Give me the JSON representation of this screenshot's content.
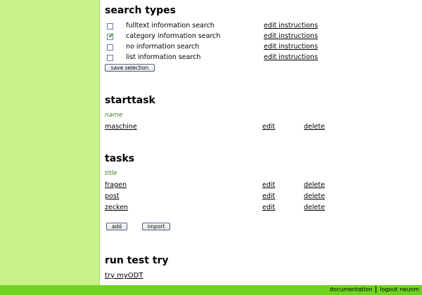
{
  "search_types": {
    "title": "search types",
    "items": [
      {
        "label": "fulltext information search",
        "checked": false,
        "action": "edit instructions"
      },
      {
        "label": "category information search",
        "checked": true,
        "action": "edit instructions"
      },
      {
        "label": "no information search",
        "checked": false,
        "action": "edit instructions"
      },
      {
        "label": "list information search",
        "checked": false,
        "action": "edit instructions"
      }
    ],
    "save_label": "save selection"
  },
  "starttask": {
    "title": "starttask",
    "column_header": "name",
    "rows": [
      {
        "name": "maschine",
        "edit": "edit",
        "delete": "delete"
      }
    ]
  },
  "tasks": {
    "title": "tasks",
    "column_header": "title",
    "rows": [
      {
        "name": "fragen",
        "edit": "edit",
        "delete": "delete"
      },
      {
        "name": "post",
        "edit": "edit",
        "delete": "delete"
      },
      {
        "name": "zecken",
        "edit": "edit",
        "delete": "delete"
      }
    ],
    "add_label": "add",
    "import_label": "import"
  },
  "run_test": {
    "title": "run test try",
    "link": "try myODT"
  },
  "footer": {
    "documentation": "documentation",
    "logout": "logout neunm"
  },
  "colors": {
    "sidebar": "#c8f28a",
    "footer": "#6ed320",
    "column_header": "#4a7a2a"
  }
}
